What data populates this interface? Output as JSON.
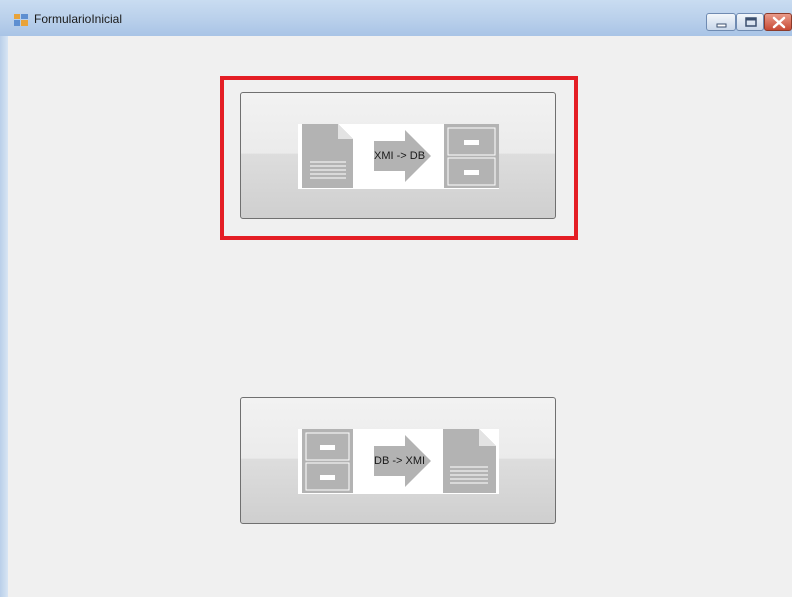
{
  "window": {
    "title": "FormularioInicial"
  },
  "buttons": {
    "xmi_to_db": {
      "label": "XMI -> DB",
      "selected": true
    },
    "db_to_xmi": {
      "label": "DB -> XMI",
      "selected": false
    }
  },
  "colors": {
    "highlight": "#e41e25",
    "icon_gray": "#b3b3b3"
  },
  "icons": [
    "app-form-icon",
    "minimize-icon",
    "maximize-icon",
    "close-icon",
    "document-icon",
    "arrow-right-icon",
    "file-cabinet-icon"
  ]
}
